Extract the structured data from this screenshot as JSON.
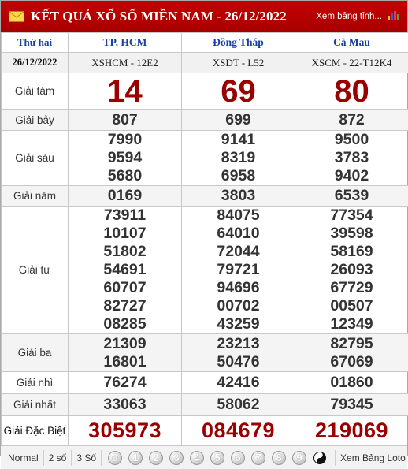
{
  "header": {
    "title": "KẾT QUẢ XỔ SỐ MIỀN NAM - 26/12/2022",
    "link_label": "Xem bảng tỉnh..."
  },
  "table_head": {
    "day": "Thứ hai",
    "date": "26/12/2022",
    "provinces": [
      {
        "name": "TP. HCM",
        "code": "XSHCM - 12E2"
      },
      {
        "name": "Đồng Tháp",
        "code": "XSDT - L52"
      },
      {
        "name": "Cà Mau",
        "code": "XSCM - 22-T12K4"
      }
    ]
  },
  "prizes": {
    "g8": {
      "label": "Giải tám",
      "values": [
        "14",
        "69",
        "80"
      ]
    },
    "g7": {
      "label": "Giải bảy",
      "values": [
        "807",
        "699",
        "872"
      ]
    },
    "g6": {
      "label": "Giải sáu",
      "values": [
        [
          "7990",
          "9594",
          "5680"
        ],
        [
          "9141",
          "8319",
          "6958"
        ],
        [
          "9500",
          "3783",
          "9402"
        ]
      ]
    },
    "g5": {
      "label": "Giải năm",
      "values": [
        "0169",
        "3803",
        "6539"
      ]
    },
    "g4": {
      "label": "Giải tư",
      "values": [
        [
          "73911",
          "10107",
          "51802",
          "54691",
          "60707",
          "82727",
          "08285"
        ],
        [
          "84075",
          "64010",
          "72044",
          "79721",
          "94696",
          "00702",
          "43259"
        ],
        [
          "77354",
          "39598",
          "58169",
          "26093",
          "67729",
          "00507",
          "12349"
        ]
      ]
    },
    "g3": {
      "label": "Giải ba",
      "values": [
        [
          "21309",
          "16801"
        ],
        [
          "23213",
          "50476"
        ],
        [
          "82795",
          "67069"
        ]
      ]
    },
    "g2": {
      "label": "Giải nhì",
      "values": [
        "76274",
        "42416",
        "01860"
      ]
    },
    "g1": {
      "label": "Giải nhất",
      "values": [
        "33063",
        "58062",
        "79345"
      ]
    },
    "gdb": {
      "label": "Giải Đặc Biệt",
      "values": [
        "305973",
        "084679",
        "219069"
      ]
    }
  },
  "footer": {
    "modes": [
      "Normal",
      "2 số",
      "3 Số"
    ],
    "digits": [
      "0",
      "1",
      "2",
      "3",
      "4",
      "5",
      "6",
      "7",
      "8",
      "9"
    ],
    "yin_yang_icon": "yin-yang-icon",
    "link_label": "Xem Bảng Loto"
  },
  "colors": {
    "header_bg": "#b00000",
    "province_text": "#1a3fa6",
    "special_number": "#9a0000"
  }
}
